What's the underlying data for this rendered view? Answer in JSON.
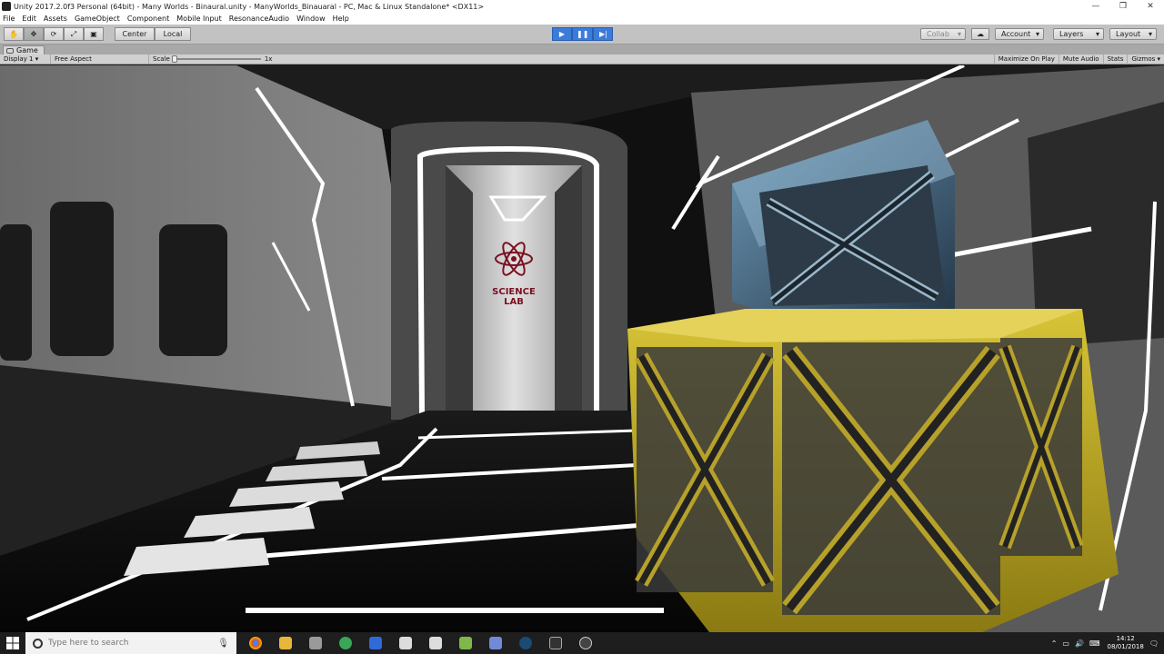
{
  "window": {
    "title": "Unity 2017.2.0f3 Personal (64bit) - Many Worlds  - Binaural.unity - ManyWorlds_Binauaral - PC, Mac & Linux Standalone* <DX11>",
    "controls": [
      "—",
      "❐",
      "✕"
    ]
  },
  "menu": [
    "File",
    "Edit",
    "Assets",
    "GameObject",
    "Component",
    "Mobile Input",
    "ResonanceAudio",
    "Window",
    "Help"
  ],
  "toolbar": {
    "pivot_label": "Center",
    "space_label": "Local",
    "collab_label": "Collab",
    "account_label": "Account",
    "layers_label": "Layers",
    "layout_label": "Layout"
  },
  "game_view": {
    "tab_label": "Game",
    "display": "Display 1",
    "aspect": "Free Aspect",
    "scale_label": "Scale",
    "scale_value": 0,
    "scale_text": "1x",
    "maximize_on_play": "Maximize On Play",
    "mute_audio": "Mute Audio",
    "stats": "Stats",
    "gizmos": "Gizmos"
  },
  "scene": {
    "door_sign_line1": "SCIENCE",
    "door_sign_line2": "LAB"
  },
  "taskbar": {
    "search_placeholder": "Type here to search",
    "time": "14:12",
    "date": "08/01/2018"
  },
  "colors": {
    "play_blue": "#3b7bd9",
    "crate_yellow": "#c9b322",
    "crate_blue": "#3e5a72"
  }
}
